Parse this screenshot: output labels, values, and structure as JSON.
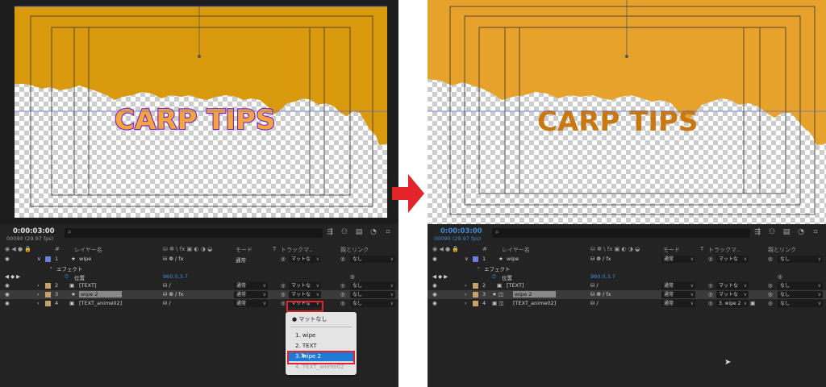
{
  "left": {
    "timecode": "0:00:03:00",
    "fps": "00090 (29.97 fps)",
    "headers": {
      "num": "#",
      "layer_name": "レイヤー名",
      "switches": "⛁ ❁ \\ fx ▣ ◐ ◑ ◒",
      "mode": "モード",
      "t": "T",
      "track": "トラックマ..",
      "parent": "親とリンク"
    },
    "rows": [
      {
        "num": "1",
        "name": "wipe",
        "mode": "通常",
        "track": "マットな",
        "parent": "なし"
      },
      {
        "num": "2",
        "name": "[TEXT]",
        "mode": "通常",
        "track": "マットな",
        "parent": "なし"
      },
      {
        "num": "3",
        "name": "wipe 2",
        "mode": "通常",
        "track": "マットな",
        "parent": "なし"
      },
      {
        "num": "4",
        "name": "[TEXT_anime02]",
        "mode": "通常",
        "track": "マットな",
        "parent": "なし"
      }
    ],
    "effects_label": "エフェクト",
    "position_label": "位置",
    "position_value": "960.0,3.7",
    "menu": {
      "items": [
        "マットなし",
        "1. wipe",
        "2. TEXT",
        "3. wipe 2",
        "4. TEXT_anime02"
      ],
      "selected_index": 3
    },
    "comp_text": "CARP TIPS"
  },
  "right": {
    "timecode": "0:00:03:00",
    "fps": "00090 (29.97 fps)",
    "headers": {
      "num": "#",
      "layer_name": "レイヤー名",
      "switches": "⛁ ❁ \\ fx ▣ ◐ ◑ ◒",
      "mode": "モード",
      "t": "T",
      "track": "トラックマ..",
      "parent": "親とリンク"
    },
    "rows": [
      {
        "num": "1",
        "name": "wipe",
        "mode": "通常",
        "track": "マットな",
        "parent": "なし"
      },
      {
        "num": "2",
        "name": "[TEXT]",
        "mode": "通常",
        "track": "マットな",
        "parent": "なし"
      },
      {
        "num": "3",
        "name": "wipe 2",
        "mode": "通常",
        "track": "マットな",
        "parent": "なし"
      },
      {
        "num": "4",
        "name": "[TEXT_anime02]",
        "mode": "通常",
        "track": "3. wipe 2",
        "parent": "なし"
      }
    ],
    "effects_label": "エフェクト",
    "position_label": "位置",
    "position_value": "960.0,3.7",
    "comp_text": "CARP TIPS"
  },
  "colors": {
    "left_fill": "#d89a0c",
    "right_fill": "#e6a22b",
    "left_text": "#f3a63a",
    "left_text_outline": "#7b1fd6",
    "right_text": "#c97810",
    "accent_blue": "#3f8bdc",
    "highlight_red": "#e4242b"
  }
}
